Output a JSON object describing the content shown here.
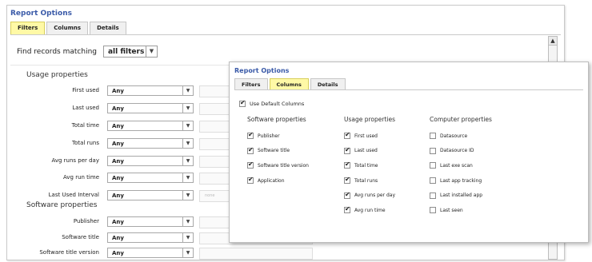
{
  "back": {
    "title": "Report Options",
    "tabs": [
      {
        "label": "Filters",
        "active": true
      },
      {
        "label": "Columns",
        "active": false
      },
      {
        "label": "Details",
        "active": false
      }
    ],
    "scroll_up_glyph": "▲",
    "find": {
      "label": "Find records matching",
      "value": "all filters",
      "arrow": "▼"
    },
    "usage_heading": "Usage properties",
    "usage_rows": [
      {
        "label": "First used",
        "value": "Any",
        "placeholder": ""
      },
      {
        "label": "Last used",
        "value": "Any",
        "placeholder": ""
      },
      {
        "label": "Total time",
        "value": "Any",
        "placeholder": ""
      },
      {
        "label": "Total runs",
        "value": "Any",
        "placeholder": ""
      },
      {
        "label": "Avg runs per day",
        "value": "Any",
        "placeholder": ""
      },
      {
        "label": "Avg run time",
        "value": "Any",
        "placeholder": ""
      },
      {
        "label": "Last Used Interval",
        "value": "Any",
        "placeholder": "none"
      }
    ],
    "software_heading": "Software properties",
    "software_rows": [
      {
        "label": "Publisher",
        "value": "Any",
        "placeholder": ""
      },
      {
        "label": "Software title",
        "value": "Any",
        "placeholder": ""
      },
      {
        "label": "Software title version",
        "value": "Any",
        "placeholder": ""
      }
    ],
    "select_arrow": "▼"
  },
  "front": {
    "title": "Report Options",
    "tabs": [
      {
        "label": "Filters",
        "active": false
      },
      {
        "label": "Columns",
        "active": true
      },
      {
        "label": "Details",
        "active": false
      }
    ],
    "use_default": {
      "label": "Use Default Columns",
      "checked": true
    },
    "columns": [
      {
        "heading": "Software properties",
        "items": [
          {
            "label": "Publisher",
            "checked": true
          },
          {
            "label": "Software title",
            "checked": true
          },
          {
            "label": "Software title version",
            "checked": true
          },
          {
            "label": "Application",
            "checked": true
          }
        ]
      },
      {
        "heading": "Usage properties",
        "items": [
          {
            "label": "First used",
            "checked": true
          },
          {
            "label": "Last used",
            "checked": true
          },
          {
            "label": "Total time",
            "checked": true
          },
          {
            "label": "Total runs",
            "checked": true
          },
          {
            "label": "Avg runs per day",
            "checked": true
          },
          {
            "label": "Avg run time",
            "checked": true
          }
        ]
      },
      {
        "heading": "Computer properties",
        "items": [
          {
            "label": "Datasource",
            "checked": false
          },
          {
            "label": "Datasource ID",
            "checked": false
          },
          {
            "label": "Last exe scan",
            "checked": false
          },
          {
            "label": "Last app tracking",
            "checked": false
          },
          {
            "label": "Last installed app",
            "checked": false
          },
          {
            "label": "Last seen",
            "checked": false
          }
        ]
      }
    ]
  },
  "colors": {
    "title": "#3a5aa8",
    "active_tab": "#fff9a6",
    "border": "#c9c9c9"
  }
}
